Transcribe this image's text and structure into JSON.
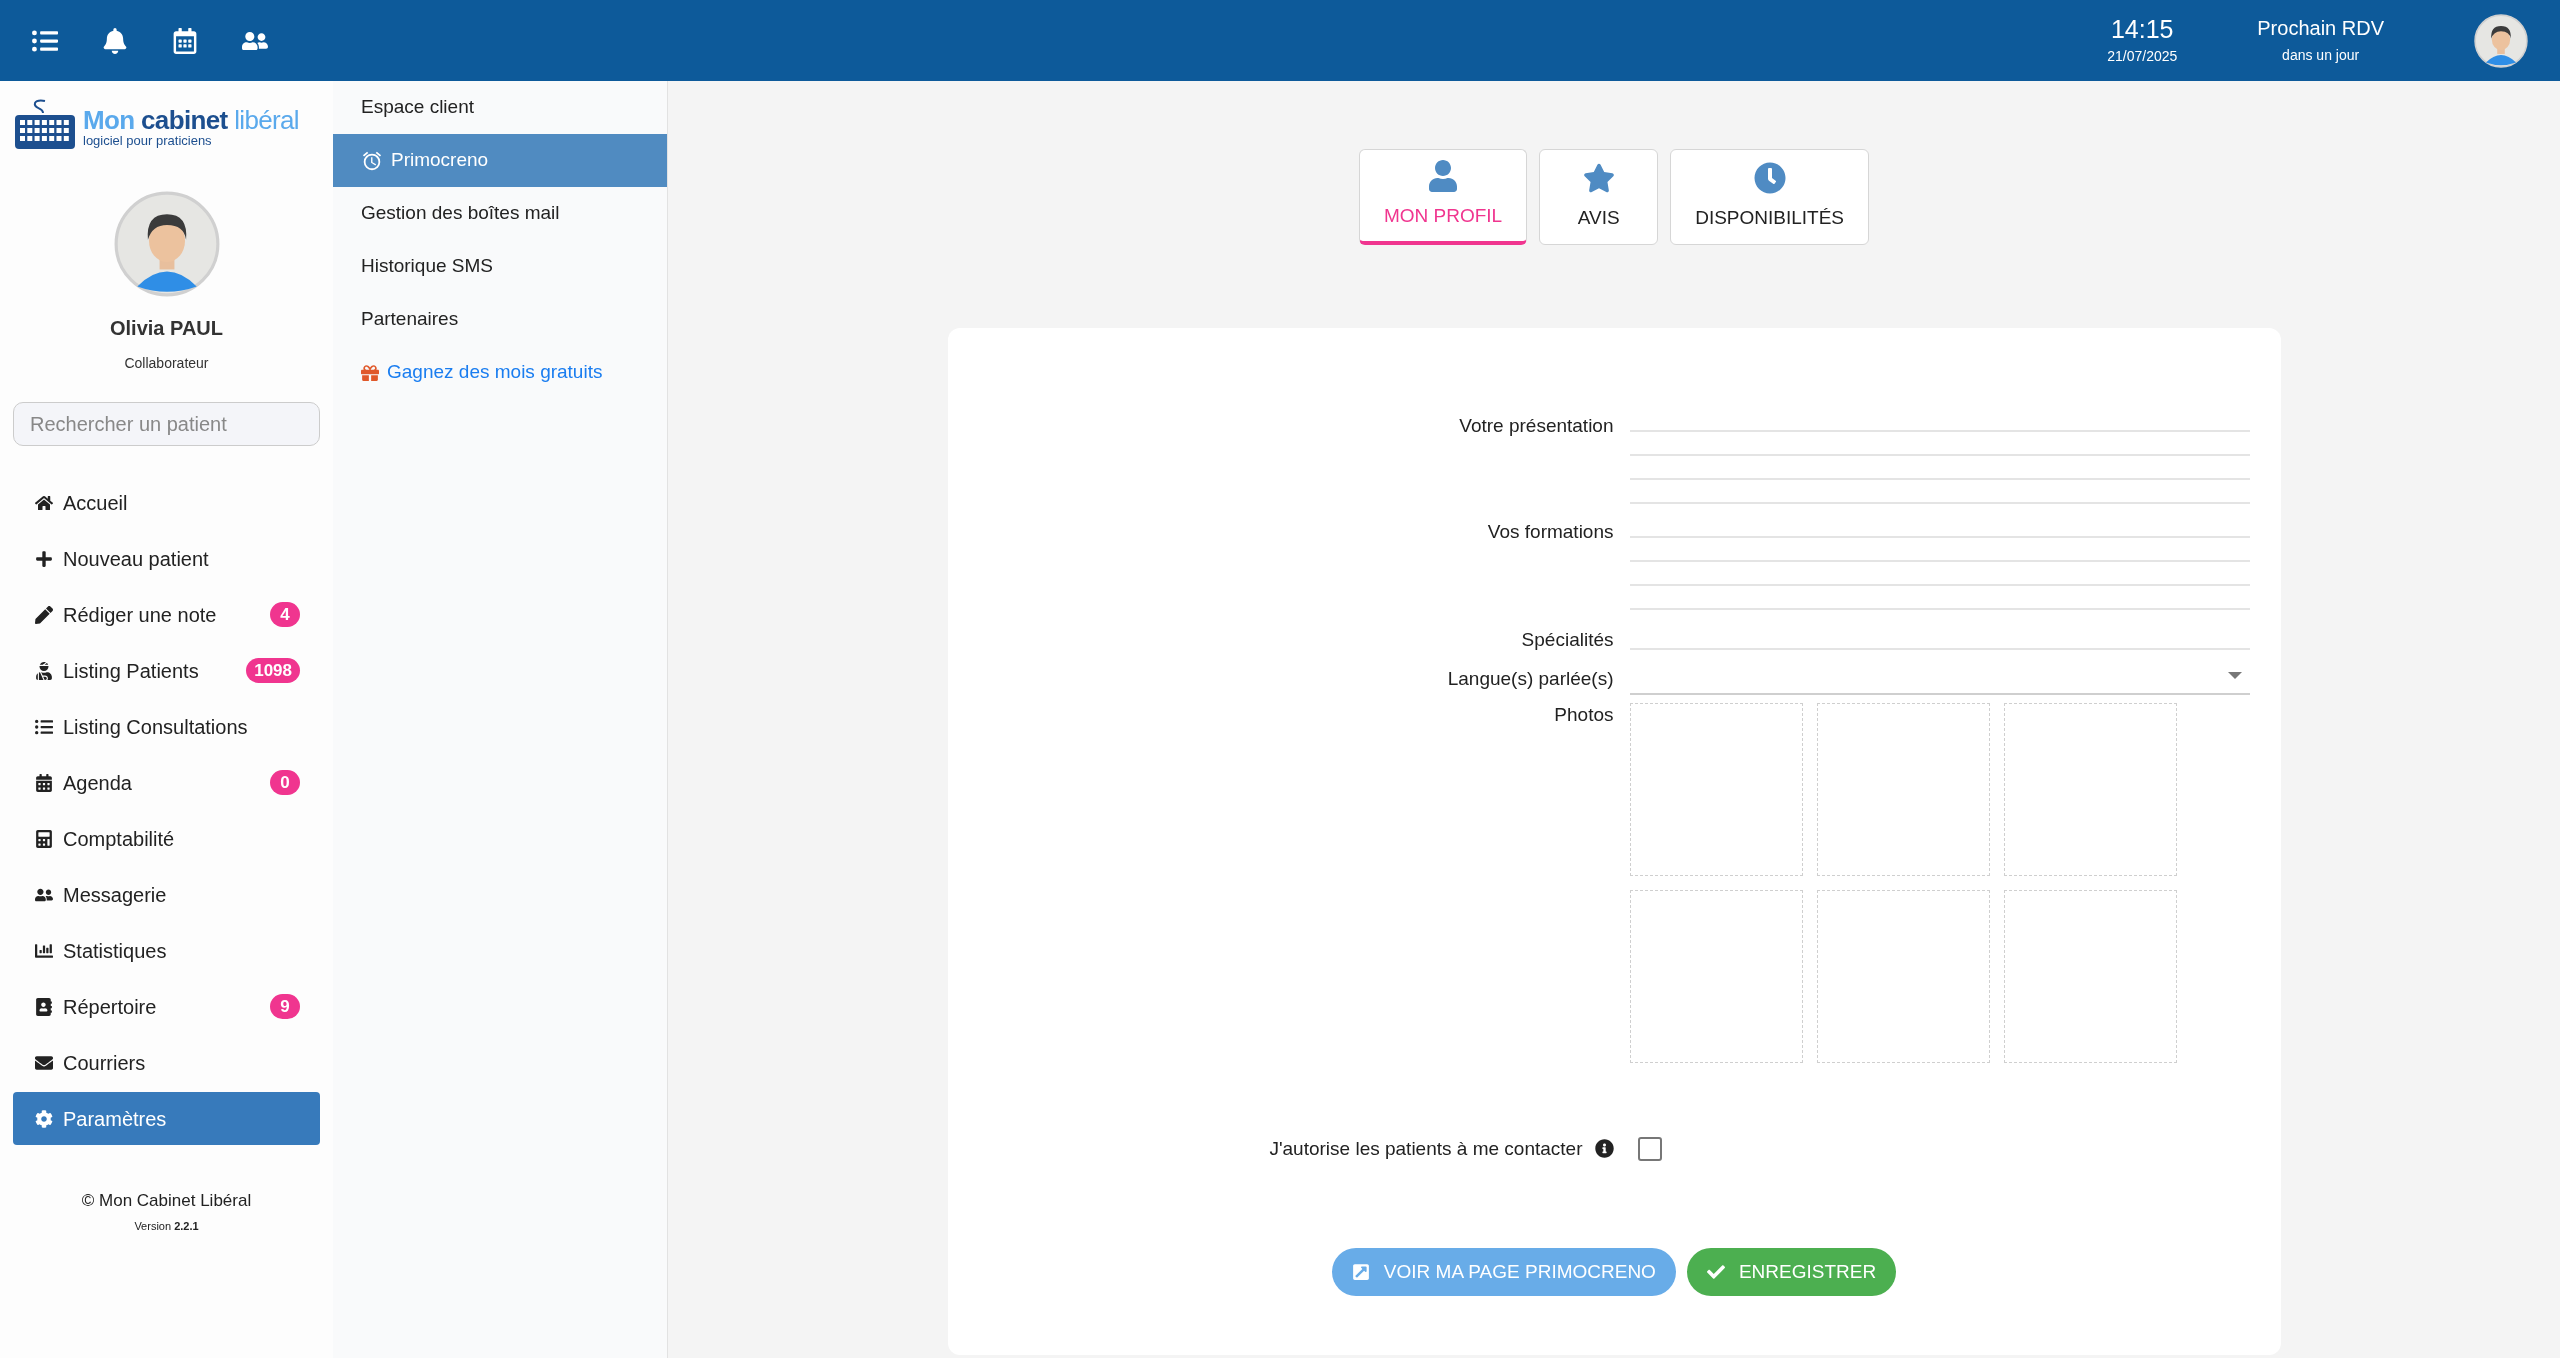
{
  "topbar": {
    "time": "14:15",
    "date": "21/07/2025",
    "next_label": "Prochain RDV",
    "next_value": "dans un jour"
  },
  "sidebar": {
    "logo": {
      "part_1": "Mon",
      "part_2": "cabinet",
      "part_3": "libéral",
      "tagline": "logiciel pour praticiens"
    },
    "user": {
      "name": "Olivia PAUL",
      "role": "Collaborateur"
    },
    "search": {
      "placeholder": "Rechercher un patient"
    },
    "items": [
      {
        "label": "Accueil",
        "selected": false
      },
      {
        "label": "Nouveau patient",
        "selected": false
      },
      {
        "label": "Rédiger une note",
        "badge": "4",
        "selected": false
      },
      {
        "label": "Listing Patients",
        "badge": "1098",
        "selected": false
      },
      {
        "label": "Listing Consultations",
        "selected": false
      },
      {
        "label": "Agenda",
        "badge": "0",
        "selected": false
      },
      {
        "label": "Comptabilité",
        "selected": false
      },
      {
        "label": "Messagerie",
        "selected": false
      },
      {
        "label": "Statistiques",
        "selected": false
      },
      {
        "label": "Répertoire",
        "badge": "9",
        "selected": false
      },
      {
        "label": "Courriers",
        "selected": false
      },
      {
        "label": "Paramètres",
        "selected": true
      }
    ],
    "footer": {
      "copyright": "© Mon Cabinet Libéral",
      "version": "Version **2.2.1**"
    }
  },
  "submenu": [
    {
      "label": "Espace client",
      "kind": "item",
      "selected": false
    },
    {
      "label": "Primocreno",
      "kind": "item",
      "selected": true
    },
    {
      "label": "Gestion des boîtes mail",
      "kind": "item",
      "selected": false
    },
    {
      "label": "Historique SMS",
      "kind": "item",
      "selected": false
    },
    {
      "label": "Partenaires",
      "kind": "item",
      "selected": false
    },
    {
      "label": "Gagnez des mois gratuits",
      "kind": "promo",
      "selected": false
    }
  ],
  "tabs": [
    {
      "label": "MON PROFIL",
      "selected": true
    },
    {
      "label": "AVIS",
      "selected": false
    },
    {
      "label": "DISPONIBILITÉS",
      "selected": false
    }
  ],
  "form": {
    "fields": [
      {
        "label": "Votre présentation",
        "kind": "textarea"
      },
      {
        "label": "Vos formations",
        "kind": "textarea"
      },
      {
        "label": "Spécialités",
        "kind": "text"
      },
      {
        "label": "Langue(s) parlée(s)",
        "kind": "select"
      }
    ],
    "photos": {
      "label": "Photos",
      "slots": [
        {
          "filled": false
        },
        {
          "filled": false
        },
        {
          "filled": false
        },
        {
          "filled": false
        },
        {
          "filled": false
        },
        {
          "filled": false
        }
      ]
    },
    "consent": {
      "label": "J'autorise les patients à me contacter",
      "checked": false
    },
    "buttons": [
      {
        "label": "VOIR MA PAGE PRIMOCRENO",
        "kind": "link"
      },
      {
        "label": "ENREGISTRER",
        "kind": "save"
      }
    ]
  }
}
